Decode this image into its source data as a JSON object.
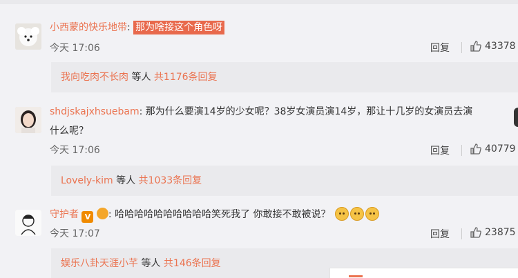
{
  "comments": [
    {
      "username": "小西蒙的快乐地带",
      "colon": ":",
      "text": "那为啥接这个角色呀",
      "time": "今天 17:06",
      "reply_label": "回复",
      "likes": "43378",
      "sub": {
        "user": "我向吃肉不长肉",
        "mid": "等人",
        "count": "共1176条回复"
      }
    },
    {
      "username": "shdjskajxhsuebam",
      "colon": ":",
      "text": "那为什么要演14岁的少女呢？38岁女演员演14岁，那让十几岁的女演员去演",
      "text_line2": "什么呢？",
      "time": "今天 17:06",
      "reply_label": "回复",
      "likes": "40779",
      "sub": {
        "user": "Lovely-kim",
        "mid": "等人",
        "count": "共1033条回复"
      }
    },
    {
      "username": "守护者",
      "colon": ":",
      "text": "哈哈哈哈哈哈哈哈哈哈笑死我了 你敢接不敢被说？",
      "time": "今天 17:07",
      "reply_label": "回复",
      "likes": "23875",
      "sub": {
        "user": "娱乐八卦天涯小芊",
        "mid": "等人",
        "count": "共146条回复"
      }
    }
  ],
  "badges": {
    "vip_letter": "V",
    "vip_color": "#f08a00",
    "fan_color": "#f4a62a"
  },
  "colors": {
    "accent": "#eb7350",
    "highlight_bg": "#e8694c",
    "background": "#f2f2f5"
  },
  "icons": {
    "like": "thumbs-up-icon",
    "emoji": "doge-emoji-icon"
  }
}
